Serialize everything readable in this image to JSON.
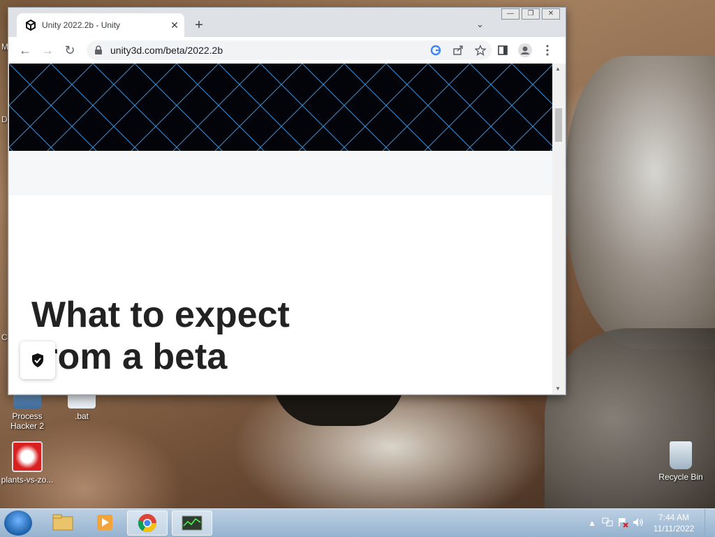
{
  "desktop": {
    "icons": [
      {
        "label": "Process Hacker 2"
      },
      {
        "label": ".bat"
      },
      {
        "label": "plants-vs-zo..."
      },
      {
        "label": "Recycle Bin"
      }
    ],
    "edge_letters": [
      "M",
      "D",
      "C"
    ]
  },
  "browser": {
    "tab": {
      "title": "Unity 2022.2b - Unity",
      "close": "✕"
    },
    "new_tab": "+",
    "tab_search": "⌄",
    "window_controls": {
      "minimize": "—",
      "restore": "❐",
      "close": "✕"
    },
    "nav": {
      "back": "←",
      "forward": "→",
      "reload": "↻"
    },
    "url": "unity3d.com/beta/2022.2b",
    "page": {
      "heading": "What to expect from a beta"
    }
  },
  "taskbar": {
    "clock_time": "7:44 AM",
    "clock_date": "11/11/2022",
    "tray_expand": "▲"
  },
  "colors": {
    "banner_grid": "#3a8fd6",
    "taskbar": "#a9c2da",
    "heading": "#222222"
  }
}
